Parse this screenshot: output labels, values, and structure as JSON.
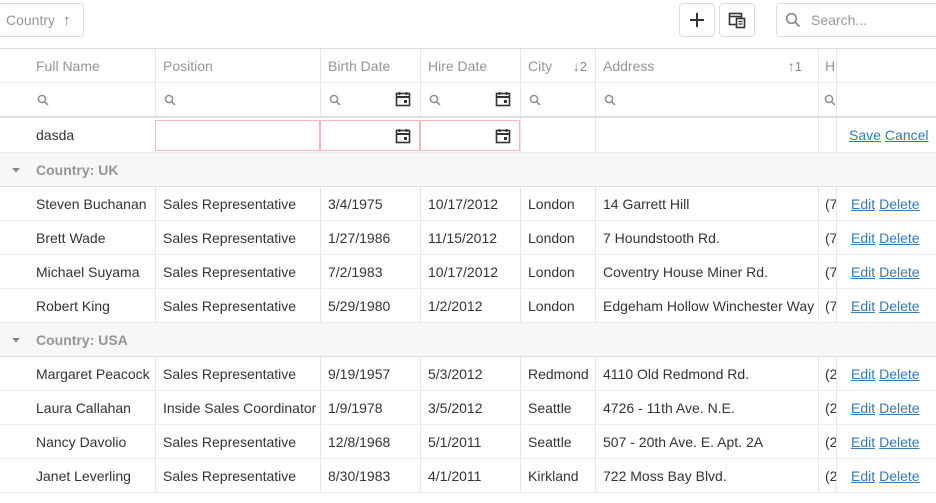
{
  "toolbar": {
    "group_chip_label": "Country",
    "search_placeholder": "Search..."
  },
  "columns": {
    "full_name": "Full Name",
    "position": "Position",
    "birth_date": "Birth Date",
    "hire_date": "Hire Date",
    "city": "City",
    "city_sort_index": "2",
    "address": "Address",
    "address_sort_index": "1",
    "phone_truncated": "H"
  },
  "edit_row": {
    "full_name_value": "dasda",
    "save_label": "Save",
    "cancel_label": "Cancel"
  },
  "groups": [
    {
      "label": "Country: UK",
      "rows": [
        {
          "name": "Steven Buchanan",
          "position": "Sales Representative",
          "birth": "3/4/1975",
          "hire": "10/17/2012",
          "city": "London",
          "address": "14 Garrett Hill",
          "phone": "(7"
        },
        {
          "name": "Brett Wade",
          "position": "Sales Representative",
          "birth": "1/27/1986",
          "hire": "11/15/2012",
          "city": "London",
          "address": "7 Houndstooth Rd.",
          "phone": "(7"
        },
        {
          "name": "Michael Suyama",
          "position": "Sales Representative",
          "birth": "7/2/1983",
          "hire": "10/17/2012",
          "city": "London",
          "address": "Coventry House Miner Rd.",
          "phone": "(7"
        },
        {
          "name": "Robert King",
          "position": "Sales Representative",
          "birth": "5/29/1980",
          "hire": "1/2/2012",
          "city": "London",
          "address": "Edgeham Hollow Winchester Way",
          "phone": "(7"
        }
      ]
    },
    {
      "label": "Country: USA",
      "rows": [
        {
          "name": "Margaret Peacock",
          "position": "Sales Representative",
          "birth": "9/19/1957",
          "hire": "5/3/2012",
          "city": "Redmond",
          "address": "4110 Old Redmond Rd.",
          "phone": "(2"
        },
        {
          "name": "Laura Callahan",
          "position": "Inside Sales Coordinator",
          "birth": "1/9/1978",
          "hire": "3/5/2012",
          "city": "Seattle",
          "address": "4726 - 11th Ave. N.E.",
          "phone": "(2"
        },
        {
          "name": "Nancy Davolio",
          "position": "Sales Representative",
          "birth": "12/8/1968",
          "hire": "5/1/2011",
          "city": "Seattle",
          "address": "507 - 20th Ave. E. Apt. 2A",
          "phone": "(2"
        },
        {
          "name": "Janet Leverling",
          "position": "Sales Representative",
          "birth": "8/30/1983",
          "hire": "4/1/2011",
          "city": "Kirkland",
          "address": "722 Moss Bay Blvd.",
          "phone": "(2"
        }
      ]
    }
  ],
  "row_actions": {
    "edit_label": "Edit",
    "delete_label": "Delete"
  }
}
